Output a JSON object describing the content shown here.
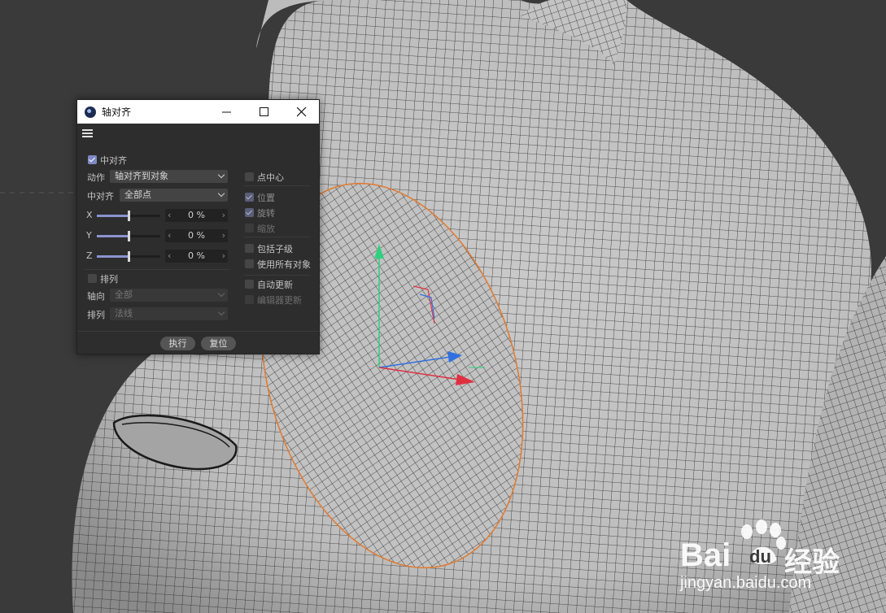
{
  "window": {
    "title": "轴对齐"
  },
  "controls": {
    "center_align_checkbox": "中对齐",
    "action_label": "动作",
    "action_value": "轴对齐到对象",
    "center_align_label": "中对齐",
    "center_align_value": "全部点",
    "axes": [
      {
        "label": "X",
        "value": "0 %",
        "slider_fraction": 0.5
      },
      {
        "label": "Y",
        "value": "0 %",
        "slider_fraction": 0.5
      },
      {
        "label": "Z",
        "value": "0 %",
        "slider_fraction": 0.5
      }
    ],
    "arrange_checkbox": "排列",
    "axis_dir_label": "轴向",
    "axis_dir_value": "全部",
    "arrange_label": "排列",
    "arrange_value": "法线",
    "right_options": [
      {
        "label": "点中心",
        "checked": false,
        "disabled": false
      },
      {
        "label": "位置",
        "checked": true,
        "disabled": true
      },
      {
        "label": "旋转",
        "checked": true,
        "disabled": true
      },
      {
        "label": "缩放",
        "checked": false,
        "disabled": true
      },
      {
        "label": "包括子级",
        "checked": false,
        "disabled": false
      },
      {
        "label": "使用所有对象",
        "checked": false,
        "disabled": false
      },
      {
        "label": "自动更新",
        "checked": false,
        "disabled": false
      },
      {
        "label": "编辑器更新",
        "checked": false,
        "disabled": true
      }
    ],
    "execute_button": "执行",
    "reset_button": "复位"
  },
  "icons": [
    "app-icon",
    "minimize-icon",
    "maximize-icon",
    "close-icon",
    "hamburger-menu-icon",
    "mouse-cursor-icon"
  ],
  "watermark": {
    "brand": "Bai",
    "brand2": "du",
    "suffix": "经验",
    "url": "jingyan.baidu.com"
  },
  "colors": {
    "accent": "#8b93cf",
    "selection_outline": "#e07a30",
    "axis_x": "#e03040",
    "axis_y": "#30d080",
    "axis_z": "#3070e0"
  }
}
